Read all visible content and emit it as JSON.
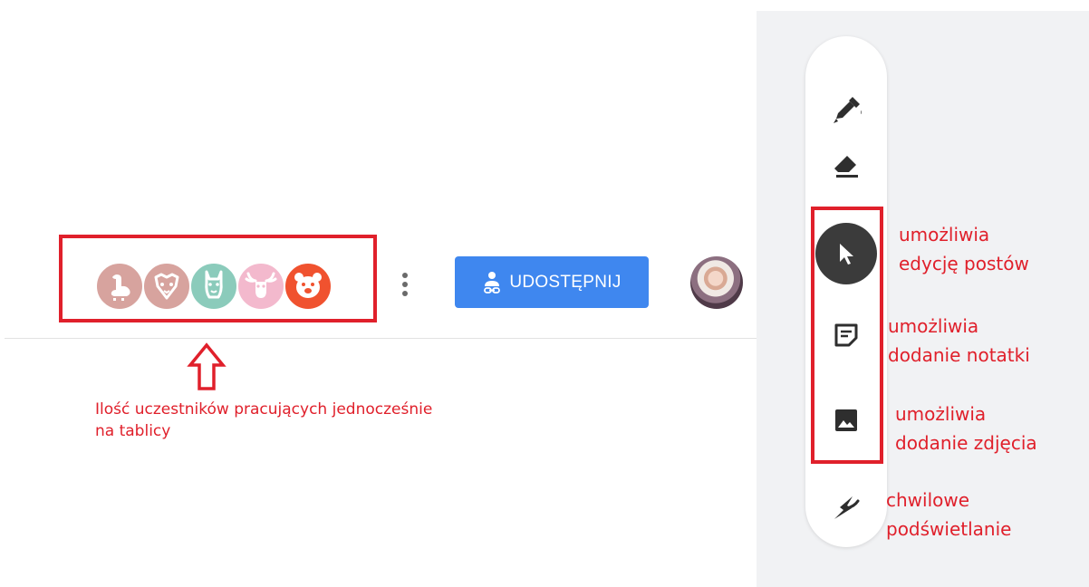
{
  "header": {
    "share_label": "UDOSTĘPNIJ"
  },
  "participants": [
    {
      "name": "goose-avatar",
      "color": "#d7a39e"
    },
    {
      "name": "lion-avatar",
      "color": "#d7a39e"
    },
    {
      "name": "llama-avatar",
      "color": "#8bcbbb"
    },
    {
      "name": "moose-avatar",
      "color": "#f3b9cd"
    },
    {
      "name": "bear-avatar",
      "color": "#f0522f"
    }
  ],
  "annotations": {
    "participants_caption_line1": "Ilość uczestników pracujących jednocześnie",
    "participants_caption_line2": "na tablicy",
    "select_line1": "umożliwia",
    "select_line2": "edycję postów",
    "note_line1": "umożliwia",
    "note_line2": "dodanie notatki",
    "image_line1": "umożliwia",
    "image_line2": "dodanie zdjęcia",
    "laser_line1": "chwilowe",
    "laser_line2": "podświetlanie"
  },
  "colors": {
    "annotation_red": "#e0202b",
    "share_blue": "#3f87ef",
    "selected_tool": "#3b3b3b",
    "panel_bg": "#f1f2f4"
  },
  "toolbar_items": [
    {
      "name": "pen-icon",
      "selected": false
    },
    {
      "name": "eraser-icon",
      "selected": false
    },
    {
      "name": "select-icon",
      "selected": true
    },
    {
      "name": "sticky-note-icon",
      "selected": false
    },
    {
      "name": "image-icon",
      "selected": false
    },
    {
      "name": "laser-icon",
      "selected": false
    }
  ]
}
